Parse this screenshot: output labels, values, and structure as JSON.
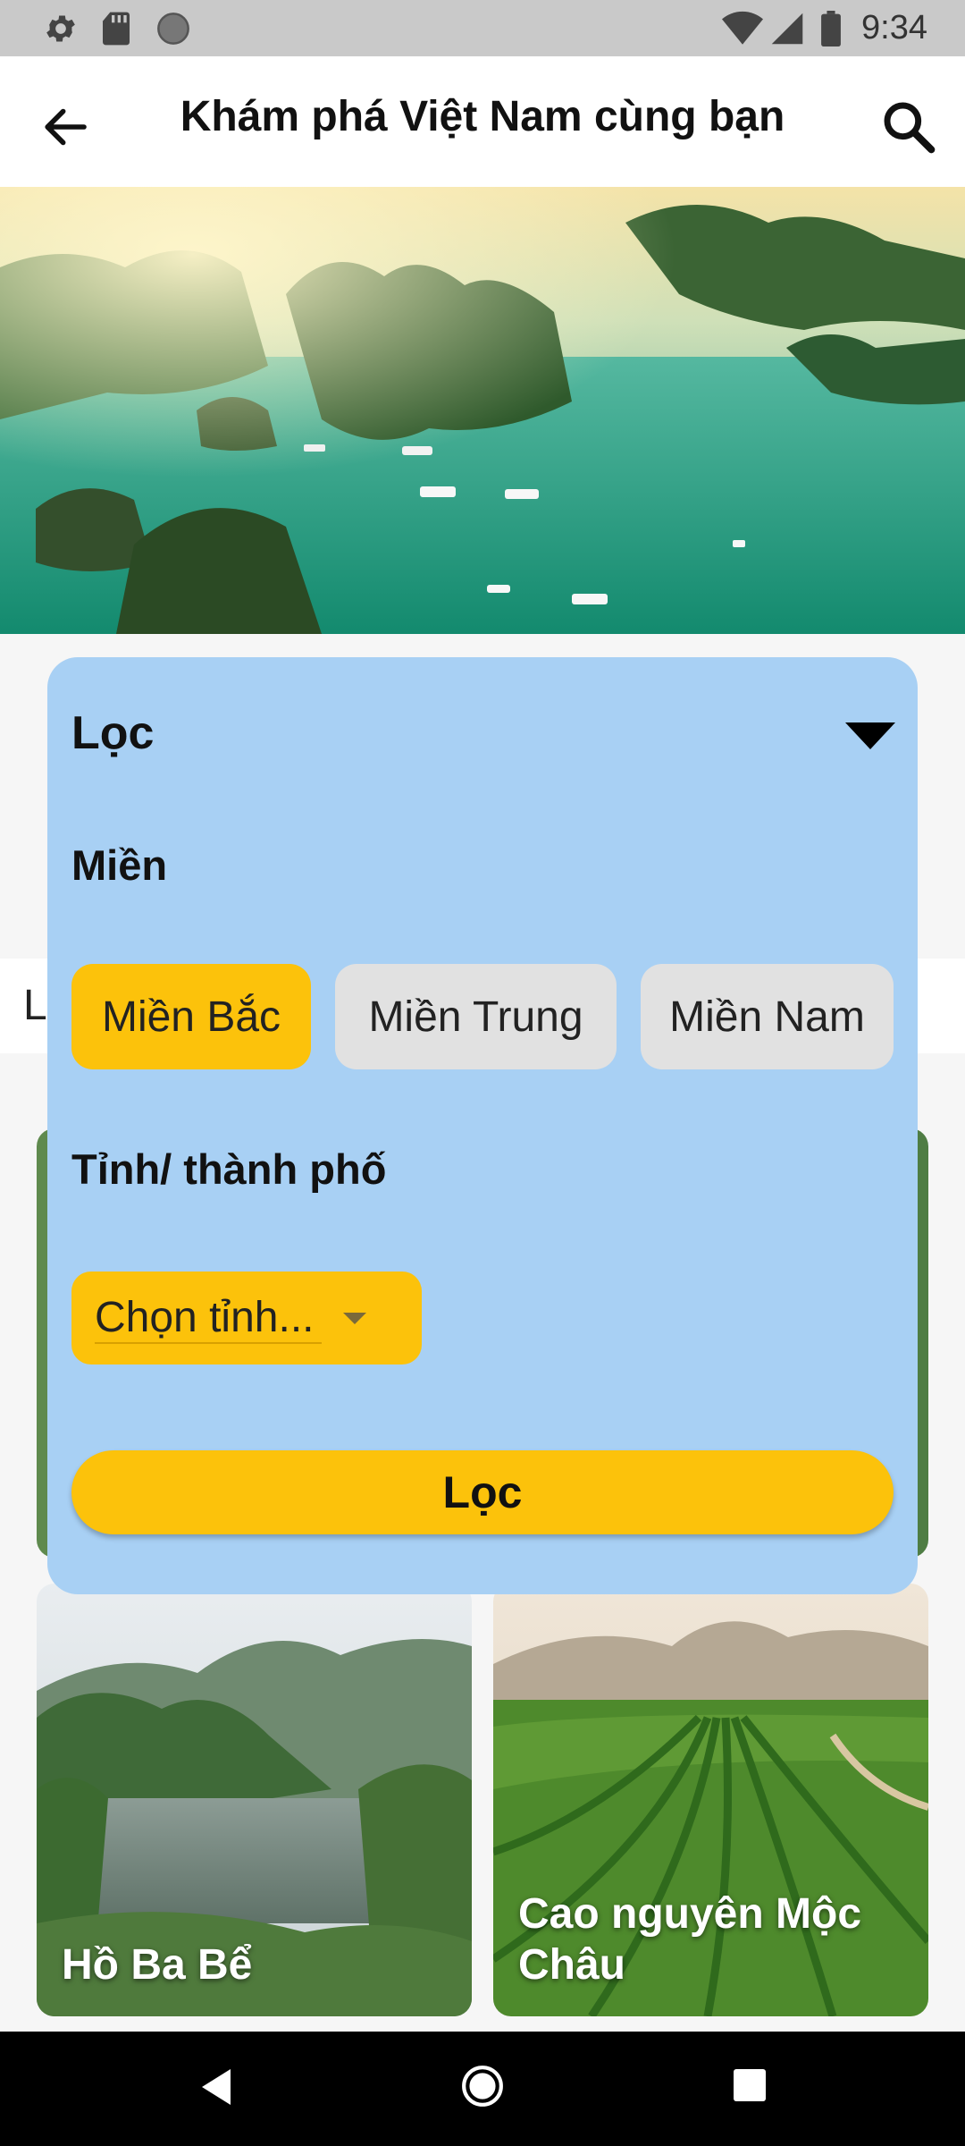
{
  "status_bar": {
    "time": "9:34"
  },
  "app_bar": {
    "title": "Khám phá Việt Nam cùng bạn"
  },
  "background": {
    "strip_partial_text": "L"
  },
  "cards": [
    {
      "label": "Hồ Ba Bể"
    },
    {
      "label": "Cao nguyên Mộc Châu"
    }
  ],
  "filter_panel": {
    "title": "Lọc",
    "region_label": "Miền",
    "regions": [
      {
        "label": "Miền Bắc",
        "selected": true
      },
      {
        "label": "Miền Trung",
        "selected": false
      },
      {
        "label": "Miền Nam",
        "selected": false
      }
    ],
    "province_label": "Tỉnh/ thành phố",
    "province_select": {
      "value": "Chọn tỉnh..."
    },
    "submit_label": "Lọc"
  },
  "colors": {
    "accent": "#fcc20b",
    "panel": "#a8d0f4",
    "chip_inactive": "#e1e1e1"
  }
}
